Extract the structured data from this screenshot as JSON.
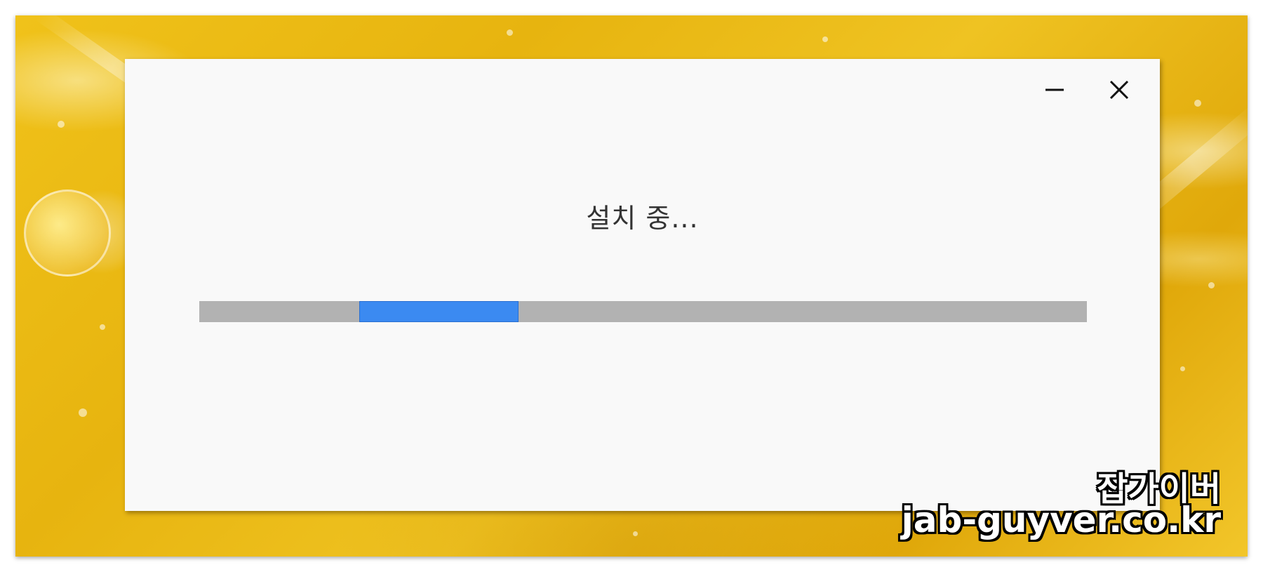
{
  "installer": {
    "status_text": "설치 중...",
    "progress_fraction": 0.18,
    "progress_offset_fraction": 0.18,
    "colors": {
      "dialog_background": "#f9f9f9",
      "track": "#b2b2b2",
      "fill": "#3b8af1",
      "text": "#333333"
    },
    "controls": {
      "minimize_icon": "minimize-icon",
      "close_icon": "close-icon"
    }
  },
  "watermark": {
    "title": "잡가이버",
    "url": "jab-guyver.co.kr"
  },
  "background": {
    "theme": "lemon-yellow",
    "accent": "#efc322"
  }
}
